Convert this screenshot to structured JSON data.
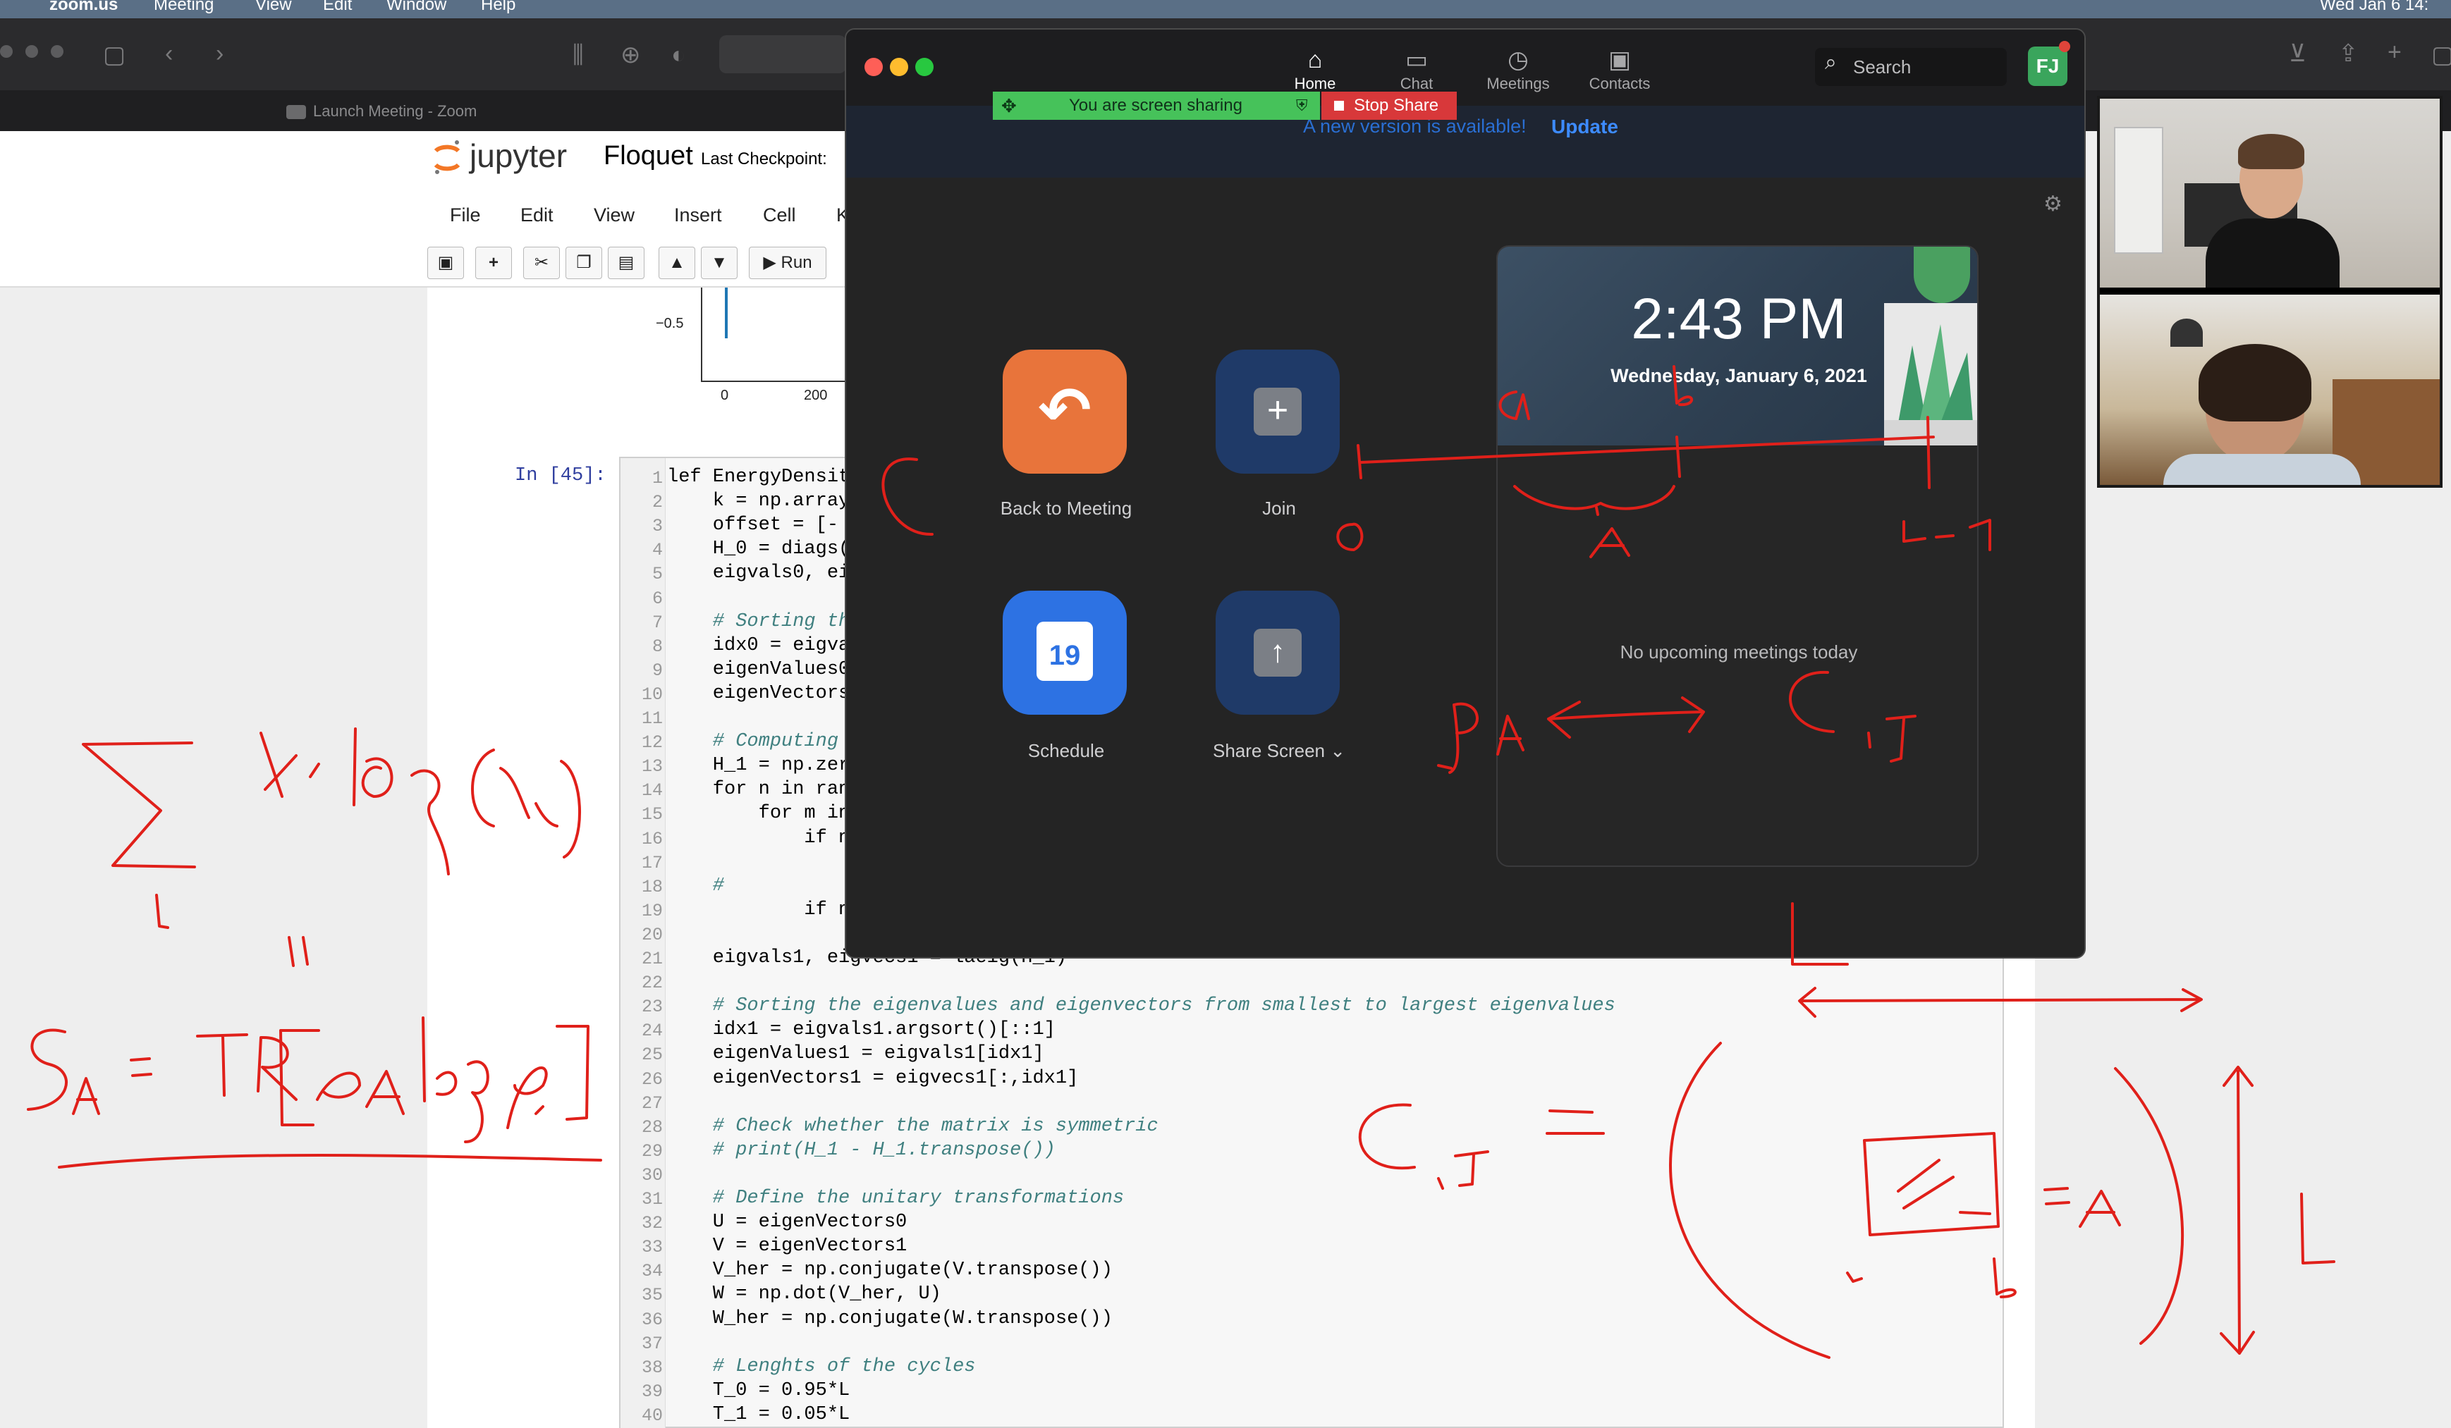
{
  "menubar": {
    "app": "zoom.us",
    "items": [
      "Meeting",
      "View",
      "Edit",
      "Window",
      "Help"
    ],
    "clock": "Wed Jan 6  14:"
  },
  "browser": {
    "tab_label": "Launch Meeting - Zoom"
  },
  "jupyter": {
    "logo": "jupyter",
    "notebook_name": "Floquet",
    "checkpoint": "Last Checkpoint:",
    "menu": [
      "File",
      "Edit",
      "View",
      "Insert",
      "Cell",
      "K"
    ],
    "run_label": "Run",
    "plot": {
      "y_tick": "−0.5",
      "x_ticks": [
        "0",
        "200"
      ]
    },
    "cell_prompt": "In [45]:",
    "code_lines": [
      {
        "n": "1",
        "t": "lef EnergyDensit",
        "c": false
      },
      {
        "n": "2",
        "t": "    k = np.array",
        "c": false
      },
      {
        "n": "3",
        "t": "    offset = [-",
        "c": false
      },
      {
        "n": "4",
        "t": "    H_0 = diags(",
        "c": false
      },
      {
        "n": "5",
        "t": "    eigvals0, ei",
        "c": false
      },
      {
        "n": "6",
        "t": "",
        "c": false
      },
      {
        "n": "7",
        "t": "    # Sorting th",
        "c": true
      },
      {
        "n": "8",
        "t": "    idx0 = eigva",
        "c": false
      },
      {
        "n": "9",
        "t": "    eigenValues0",
        "c": false
      },
      {
        "n": "10",
        "t": "    eigenVectors",
        "c": false
      },
      {
        "n": "11",
        "t": "",
        "c": false
      },
      {
        "n": "12",
        "t": "    # Computing ",
        "c": true
      },
      {
        "n": "13",
        "t": "    H_1 = np.zer",
        "c": false
      },
      {
        "n": "14",
        "t": "    for n in ran",
        "c": false
      },
      {
        "n": "15",
        "t": "        for m in",
        "c": false
      },
      {
        "n": "16",
        "t": "            if n",
        "c": false
      },
      {
        "n": "17",
        "t": "",
        "c": false
      },
      {
        "n": "18",
        "t": "    #",
        "c": true
      },
      {
        "n": "19",
        "t": "            if n",
        "c": false
      },
      {
        "n": "20",
        "t": "",
        "c": false
      },
      {
        "n": "21",
        "t": "    eigvals1, eigvecs1 = laeig(H_1)",
        "c": false
      },
      {
        "n": "22",
        "t": "",
        "c": false
      },
      {
        "n": "23",
        "t": "    # Sorting the eigenvalues and eigenvectors from smallest to largest eigenvalues",
        "c": true
      },
      {
        "n": "24",
        "t": "    idx1 = eigvals1.argsort()[::1]",
        "c": false
      },
      {
        "n": "25",
        "t": "    eigenValues1 = eigvals1[idx1]",
        "c": false
      },
      {
        "n": "26",
        "t": "    eigenVectors1 = eigvecs1[:,idx1]",
        "c": false
      },
      {
        "n": "27",
        "t": "",
        "c": false
      },
      {
        "n": "28",
        "t": "    # Check whether the matrix is symmetric",
        "c": true
      },
      {
        "n": "29",
        "t": "    # print(H_1 - H_1.transpose())",
        "c": true
      },
      {
        "n": "30",
        "t": "",
        "c": false
      },
      {
        "n": "31",
        "t": "    # Define the unitary transformations",
        "c": true
      },
      {
        "n": "32",
        "t": "    U = eigenVectors0",
        "c": false
      },
      {
        "n": "33",
        "t": "    V = eigenVectors1",
        "c": false
      },
      {
        "n": "34",
        "t": "    V_her = np.conjugate(V.transpose())",
        "c": false
      },
      {
        "n": "35",
        "t": "    W = np.dot(V_her, U)",
        "c": false
      },
      {
        "n": "36",
        "t": "    W_her = np.conjugate(W.transpose())",
        "c": false
      },
      {
        "n": "37",
        "t": "",
        "c": false
      },
      {
        "n": "38",
        "t": "    # Lenghts of the cycles",
        "c": true
      },
      {
        "n": "39",
        "t": "    T_0 = 0.95*L",
        "c": false
      },
      {
        "n": "40",
        "t": "    T_1 = 0.05*L",
        "c": false
      }
    ]
  },
  "zoom": {
    "nav": [
      {
        "label": "Home",
        "icon": "home-icon",
        "glyph": "⌂"
      },
      {
        "label": "Chat",
        "icon": "chat-icon",
        "glyph": "▭"
      },
      {
        "label": "Meetings",
        "icon": "clock-icon",
        "glyph": "◷"
      },
      {
        "label": "Contacts",
        "icon": "contacts-icon",
        "glyph": "▣"
      }
    ],
    "search_placeholder": "Search",
    "avatar": "FJ",
    "banner_text": "A new version is available!",
    "banner_link": "Update",
    "sharing_text": "You are screen sharing",
    "stop_share": "Stop Share",
    "actions": [
      {
        "label": "Back to Meeting",
        "color": "#e8743b",
        "glyph": "↶"
      },
      {
        "label": "Join",
        "color": "#1f3a68",
        "glyph": "+"
      },
      {
        "label": "Schedule",
        "color": "#2d72e3",
        "glyph": "19"
      },
      {
        "label": "Share Screen  ⌄",
        "color": "#1f3a68",
        "glyph": "↑"
      }
    ],
    "calendar": {
      "time": "2:43 PM",
      "date": "Wednesday, January 6, 2021",
      "empty": "No upcoming meetings today"
    }
  },
  "colors": {
    "ink": "#e0201a",
    "zoom_bg": "#242424",
    "share_green": "#46c25a",
    "stop_red": "#d8383a"
  }
}
